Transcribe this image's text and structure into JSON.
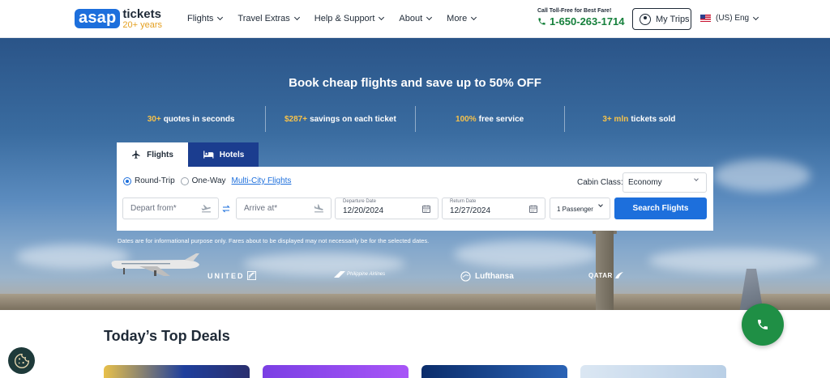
{
  "header": {
    "logo": {
      "brand": "asap",
      "tickets": "tickets",
      "years": "20+ years"
    },
    "nav": [
      {
        "label": "Flights"
      },
      {
        "label": "Travel Extras"
      },
      {
        "label": "Help & Support"
      },
      {
        "label": "About"
      },
      {
        "label": "More"
      }
    ],
    "call": {
      "label": "Call Toll-Free for Best Fare!",
      "phone": "1-650-263-1714"
    },
    "my_trips_label": "My Trips",
    "language": "(US) Eng"
  },
  "hero": {
    "title": "Book cheap flights and save up to 50% OFF",
    "stats": [
      {
        "highlight": "30+",
        "text": "quotes in seconds"
      },
      {
        "highlight": "$287+",
        "text": "savings on each ticket"
      },
      {
        "highlight": "100%",
        "text": "free service"
      },
      {
        "highlight": "3+ mln",
        "text": "tickets sold"
      }
    ],
    "tabs": {
      "flights": "Flights",
      "hotels": "Hotels"
    },
    "search": {
      "trip_types": {
        "round": "Round-Trip",
        "oneway": "One-Way",
        "multi": "Multi-City Flights"
      },
      "selected_trip": "Round-Trip",
      "cabin_label": "Cabin Class:",
      "cabin_value": "Economy",
      "depart_placeholder": "Depart from*",
      "arrive_placeholder": "Arrive at*",
      "departure_label": "Departure Date",
      "departure_value": "12/20/2024",
      "return_label": "Return Date",
      "return_value": "12/27/2024",
      "passengers": "1 Passenger",
      "button": "Search Flights"
    },
    "disclaimer": "Dates are for informational purpose only. Fares about to be displayed may not necessarily be for the selected dates.",
    "airlines": {
      "united": "UNITED",
      "philippine": "Philippine Airlines",
      "lufthansa": "Lufthansa",
      "qatar": "QATAR"
    }
  },
  "deals": {
    "title": "Today’s Top Deals"
  },
  "colors": {
    "primary": "#1d6fdc",
    "navy": "#1b3d8f",
    "green": "#16803c",
    "accent": "#f6c24b"
  }
}
